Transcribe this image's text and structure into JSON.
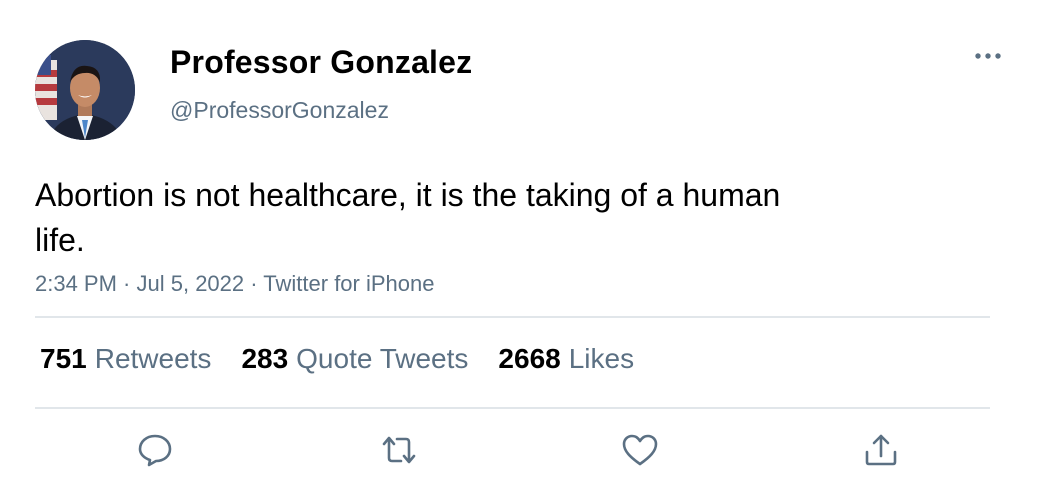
{
  "tweet": {
    "author_name": "Professor Gonzalez",
    "author_handle": "@ProfessorGonzalez",
    "text": "Abortion is not healthcare, it is the taking of a human life.",
    "time": "2:34 PM",
    "date": "Jul 5, 2022",
    "source": "Twitter for iPhone",
    "separator": " · "
  },
  "stats": [
    {
      "count": "751",
      "label": "Retweets"
    },
    {
      "count": "283",
      "label": "Quote Tweets"
    },
    {
      "count": "2668",
      "label": "Likes"
    }
  ],
  "actions": [
    {
      "icon": "reply-icon"
    },
    {
      "icon": "retweet-icon"
    },
    {
      "icon": "like-icon"
    },
    {
      "icon": "share-icon"
    }
  ],
  "colors": {
    "secondary_text": "#5b7083",
    "divider": "#e1e6ea",
    "icon": "#5b7083"
  }
}
